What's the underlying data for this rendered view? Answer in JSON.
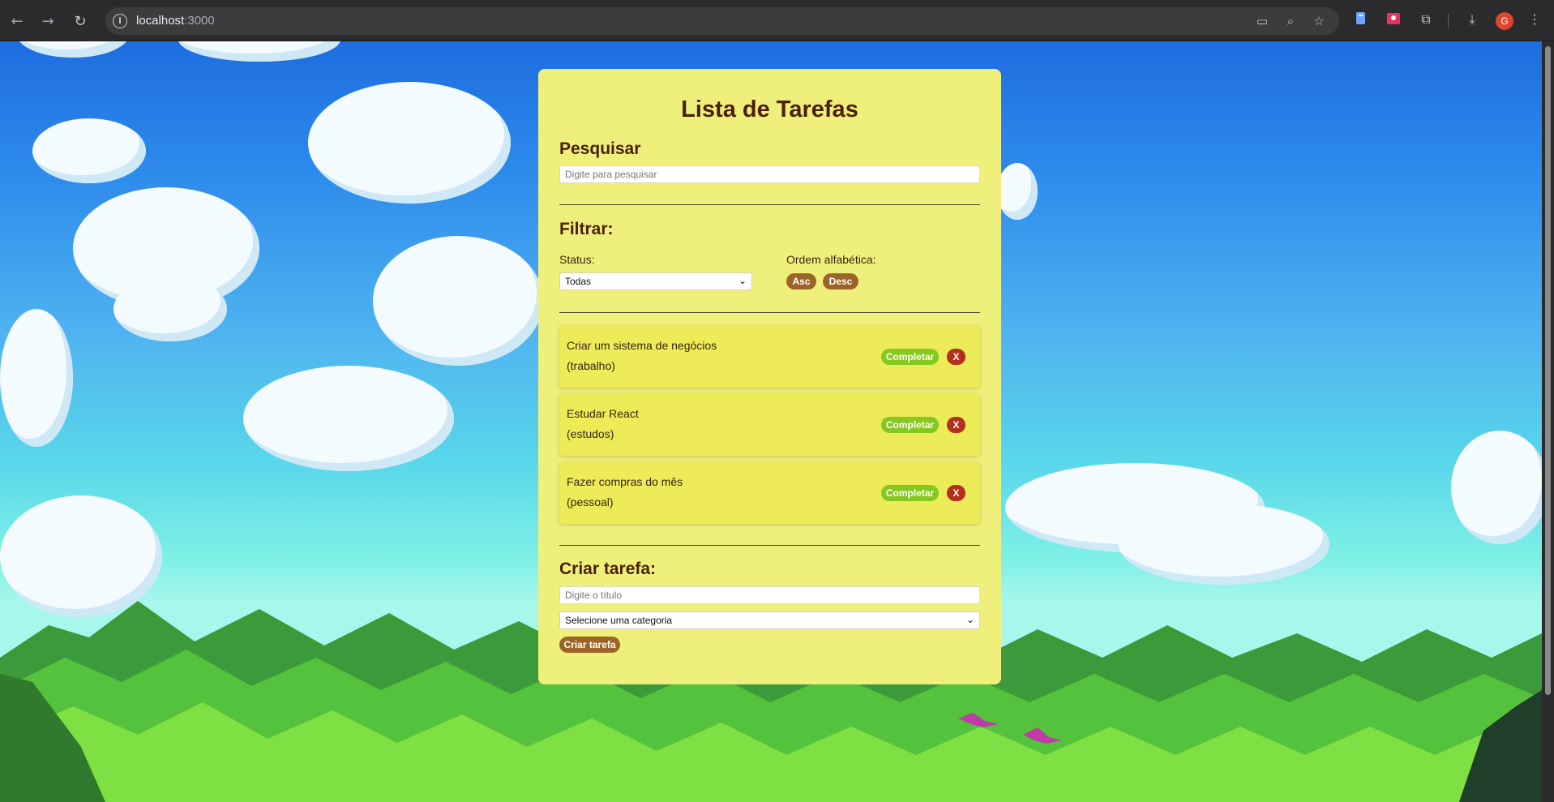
{
  "browser": {
    "url_host": "localhost",
    "url_port": ":3000",
    "profile_initial": "G"
  },
  "app": {
    "title": "Lista de Tarefas",
    "search": {
      "heading": "Pesquisar",
      "placeholder": "Digite para pesquisar"
    },
    "filter": {
      "heading": "Filtrar:",
      "status_label": "Status:",
      "status_value": "Todas",
      "order_label": "Ordem alfabética:",
      "asc_label": "Asc",
      "desc_label": "Desc"
    },
    "tasks": [
      {
        "title": "Criar um sistema de negócios",
        "category": "(trabalho)",
        "complete_label": "Completar",
        "remove_label": "X"
      },
      {
        "title": "Estudar React",
        "category": "(estudos)",
        "complete_label": "Completar",
        "remove_label": "X"
      },
      {
        "title": "Fazer compras do mês",
        "category": "(pessoal)",
        "complete_label": "Completar",
        "remove_label": "X"
      }
    ],
    "create": {
      "heading": "Criar tarefa:",
      "title_placeholder": "Digite o título",
      "category_value": "Selecione uma categoria",
      "submit_label": "Criar tarefa"
    }
  },
  "colors": {
    "card": "#eef07b",
    "task_card": "#ebec58",
    "heading": "#4a1f0c",
    "complete_button": "#85c81f",
    "remove_button": "#b3301d",
    "brown_button": "#9b6527"
  }
}
